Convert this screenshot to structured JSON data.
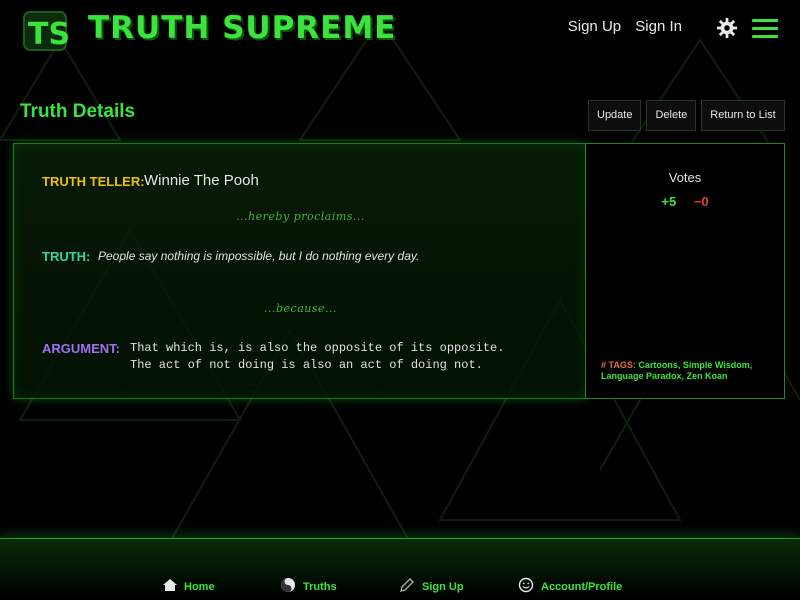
{
  "header": {
    "brand": "TRUTH SUPREME",
    "sign_up": "Sign Up",
    "sign_in": "Sign In"
  },
  "page": {
    "title": "Truth Details",
    "actions": {
      "update": "Update",
      "delete": "Delete",
      "return": "Return to List"
    }
  },
  "truth": {
    "teller_label": "TRUTH TELLER:",
    "teller_name": "Winnie The Pooh",
    "proclaims": "...hereby proclaims...",
    "truth_label": "TRUTH:",
    "truth_text": "People say nothing is impossible, but I do nothing every day.",
    "because": "...because...",
    "argument_label": "ARGUMENT:",
    "argument_line1": "That which is, is also the opposite of its opposite.",
    "argument_line2": "The act of not doing is also an act of doing not."
  },
  "votes": {
    "title": "Votes",
    "up": "+5",
    "down": "−0",
    "tags_label": "# TAGS:",
    "tags": "Cartoons, Simple Wisdom, Language Paradox, Zen Koan"
  },
  "footer": {
    "home": "Home",
    "truths": "Truths",
    "sign_up": "Sign Up",
    "account": "Account/Profile"
  },
  "colors": {
    "accent": "#3de33d",
    "teller": "#f0c000",
    "truth": "#30d8a0",
    "argument": "#a070f0",
    "downvote": "#e03c3c",
    "tags_label": "#e0703a"
  }
}
